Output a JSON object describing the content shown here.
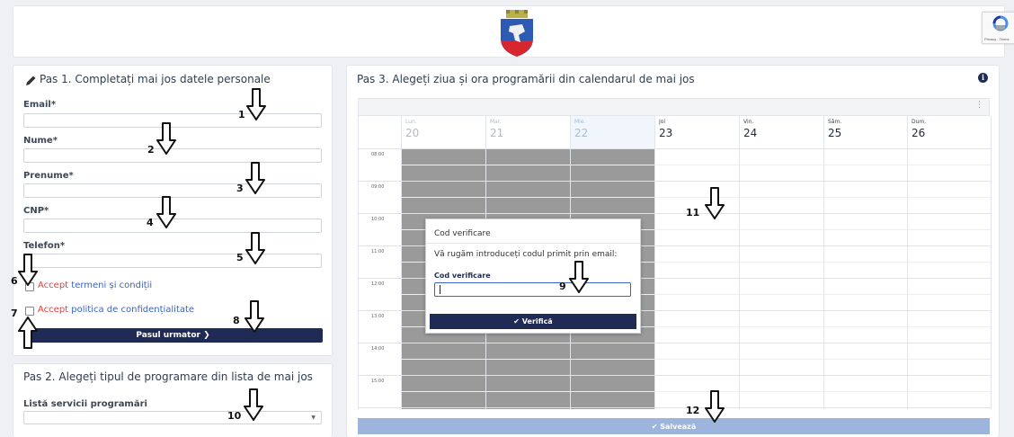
{
  "header": {
    "recaptcha_text": "Privacy - Terms"
  },
  "step1": {
    "title": "Pas 1. Completați mai jos datele personale",
    "fields": [
      {
        "label": "Email*",
        "value": ""
      },
      {
        "label": "Nume*",
        "value": ""
      },
      {
        "label": "Prenume*",
        "value": ""
      },
      {
        "label": "CNP*",
        "value": ""
      },
      {
        "label": "Telefon*",
        "value": ""
      }
    ],
    "terms_accept": "Accept",
    "terms_link": "termeni și condiții",
    "privacy_accept": "Accept",
    "privacy_link": "politica de confidențialitate",
    "next_button": "Pasul urmator ❯"
  },
  "step2": {
    "title": "Pas 2. Alegeți tipul de programare din lista de mai jos",
    "select_label": "Listă servicii programări",
    "select_value": ""
  },
  "step3": {
    "title": "Pas 3. Alegeți ziua și ora programării din calendarul de mai jos",
    "days": [
      {
        "name": "Lun.",
        "num": "20"
      },
      {
        "name": "Mar.",
        "num": "21"
      },
      {
        "name": "Mie.",
        "num": "22"
      },
      {
        "name": "Joi",
        "num": "23"
      },
      {
        "name": "Vin.",
        "num": "24"
      },
      {
        "name": "Sâm.",
        "num": "25"
      },
      {
        "name": "Dum.",
        "num": "26"
      }
    ],
    "times": [
      "08:00",
      "09:00",
      "10:00",
      "11:00",
      "12:00",
      "13:00",
      "14:00",
      "15:00"
    ],
    "save_button": "✔ Salvează"
  },
  "modal": {
    "title": "Cod verificare",
    "message": "Vă rugăm introduceți codul primit prin email:",
    "field_label": "Cod verificare",
    "field_value": "",
    "verify_button": "✔ Verifică"
  },
  "annotations": [
    "1",
    "2",
    "3",
    "4",
    "5",
    "6",
    "7",
    "8",
    "9",
    "10",
    "11",
    "12"
  ]
}
